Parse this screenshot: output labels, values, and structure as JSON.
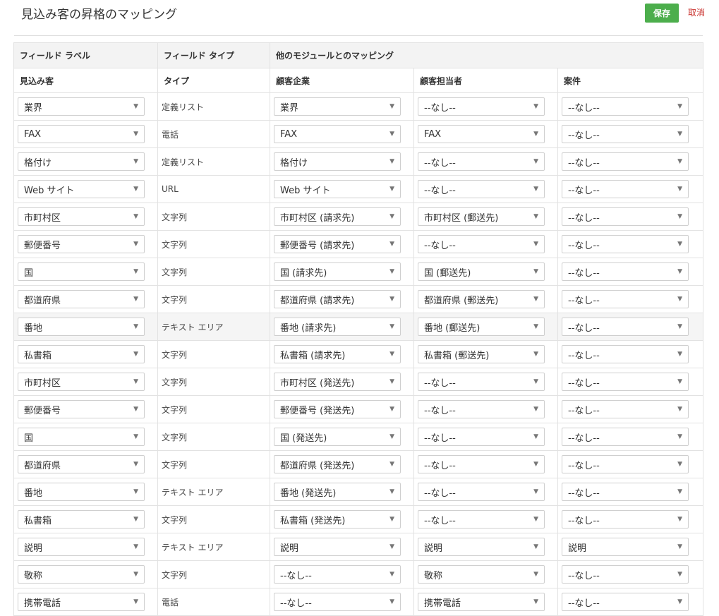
{
  "page": {
    "title": "見込み客の昇格のマッピング",
    "save_label": "保存",
    "cancel_label": "取消"
  },
  "colors": {
    "save": "#4cae4c",
    "cancel": "#c9302c"
  },
  "header": {
    "field_label": "フィールド ラベル",
    "field_type": "フィールド タイプ",
    "mapping": "他のモジュールとのマッピング",
    "lead": "見込み客",
    "type": "タイプ",
    "account": "顧客企業",
    "contact": "顧客担当者",
    "deal": "案件"
  },
  "icons": {
    "caret": "▼"
  },
  "rows": [
    {
      "lead": "業界",
      "type": "定義リスト",
      "account": "業界",
      "contact": "--なし--",
      "deal": "--なし--"
    },
    {
      "lead": "FAX",
      "type": "電話",
      "account": "FAX",
      "contact": "FAX",
      "deal": "--なし--"
    },
    {
      "lead": "格付け",
      "type": "定義リスト",
      "account": "格付け",
      "contact": "--なし--",
      "deal": "--なし--"
    },
    {
      "lead": "Web サイト",
      "type": "URL",
      "account": "Web サイト",
      "contact": "--なし--",
      "deal": "--なし--"
    },
    {
      "lead": "市町村区",
      "type": "文字列",
      "account": "市町村区 (請求先)",
      "contact": "市町村区 (郵送先)",
      "deal": "--なし--"
    },
    {
      "lead": "郵便番号",
      "type": "文字列",
      "account": "郵便番号 (請求先)",
      "contact": "--なし--",
      "deal": "--なし--"
    },
    {
      "lead": "国",
      "type": "文字列",
      "account": "国 (請求先)",
      "contact": "国 (郵送先)",
      "deal": "--なし--"
    },
    {
      "lead": "都道府県",
      "type": "文字列",
      "account": "都道府県 (請求先)",
      "contact": "都道府県 (郵送先)",
      "deal": "--なし--"
    },
    {
      "lead": "番地",
      "type": "テキスト エリア",
      "account": "番地 (請求先)",
      "contact": "番地 (郵送先)",
      "deal": "--なし--"
    },
    {
      "lead": "私書箱",
      "type": "文字列",
      "account": "私書箱 (請求先)",
      "contact": "私書箱 (郵送先)",
      "deal": "--なし--"
    },
    {
      "lead": "市町村区",
      "type": "文字列",
      "account": "市町村区 (発送先)",
      "contact": "--なし--",
      "deal": "--なし--"
    },
    {
      "lead": "郵便番号",
      "type": "文字列",
      "account": "郵便番号 (発送先)",
      "contact": "--なし--",
      "deal": "--なし--"
    },
    {
      "lead": "国",
      "type": "文字列",
      "account": "国 (発送先)",
      "contact": "--なし--",
      "deal": "--なし--"
    },
    {
      "lead": "都道府県",
      "type": "文字列",
      "account": "都道府県 (発送先)",
      "contact": "--なし--",
      "deal": "--なし--"
    },
    {
      "lead": "番地",
      "type": "テキスト エリア",
      "account": "番地 (発送先)",
      "contact": "--なし--",
      "deal": "--なし--"
    },
    {
      "lead": "私書箱",
      "type": "文字列",
      "account": "私書箱 (発送先)",
      "contact": "--なし--",
      "deal": "--なし--"
    },
    {
      "lead": "説明",
      "type": "テキスト エリア",
      "account": "説明",
      "contact": "説明",
      "deal": "説明"
    },
    {
      "lead": "敬称",
      "type": "文字列",
      "account": "--なし--",
      "contact": "敬称",
      "deal": "--なし--"
    },
    {
      "lead": "携帯電話",
      "type": "電話",
      "account": "--なし--",
      "contact": "携帯電話",
      "deal": "--なし--"
    }
  ]
}
